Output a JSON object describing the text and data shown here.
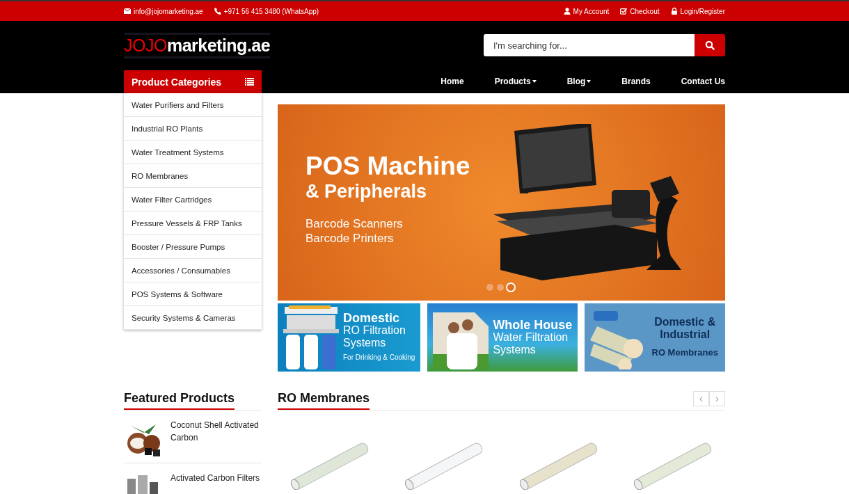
{
  "top_bar": {
    "email": "info@jojomarketing.ae",
    "phone": "+971 56 415 3480 (WhatsApp)",
    "links": [
      {
        "label": "My Account",
        "kind": "account"
      },
      {
        "label": "Checkout",
        "kind": "checkout"
      },
      {
        "label": "Login/Register",
        "kind": "login"
      }
    ]
  },
  "logo": {
    "accent": "JOJO",
    "rest": "marketing.ae"
  },
  "search": {
    "placeholder": "I'm searching for..."
  },
  "nav": [
    {
      "label": "Home",
      "dropdown": false
    },
    {
      "label": "Products",
      "dropdown": true
    },
    {
      "label": "Blog",
      "dropdown": true
    },
    {
      "label": "Brands",
      "dropdown": false
    },
    {
      "label": "Contact Us",
      "dropdown": false
    }
  ],
  "sidebar": {
    "title": "Product Categories",
    "items": [
      "Water Purifiers and Filters",
      "Industrial RO Plants",
      "Water Treatment Systems",
      "RO Membranes",
      "Water Filter Cartridges",
      "Pressure Vessels & FRP Tanks",
      "Booster / Pressure Pumps",
      "Accessories / Consumables",
      "POS Systems & Software",
      "Security Systems & Cameras"
    ]
  },
  "slider": {
    "title": "POS Machine",
    "subtitle": "& Peripherals",
    "lines": [
      "Barcode Scanners",
      "Barcode Printers"
    ],
    "dots": [
      {
        "selected": false
      },
      {
        "selected": false
      },
      {
        "selected": true
      }
    ]
  },
  "promos": [
    {
      "kind": "domestic",
      "lines": [
        "Domestic",
        "RO Filtration",
        "Systems",
        "For Drinking & Cooking"
      ]
    },
    {
      "kind": "house",
      "lines": [
        "Whole House",
        "Water Filtration",
        "Systems"
      ]
    },
    {
      "kind": "membrane",
      "lines": [
        "Domestic &",
        "Industrial",
        "RO Membranes"
      ]
    }
  ],
  "featured": {
    "title": "Featured Products",
    "items": [
      "Coconut Shell Activated Carbon",
      "Activated Carbon Filters"
    ]
  },
  "products_section": {
    "title": "RO Membranes",
    "prev": "‹",
    "next": "›"
  }
}
